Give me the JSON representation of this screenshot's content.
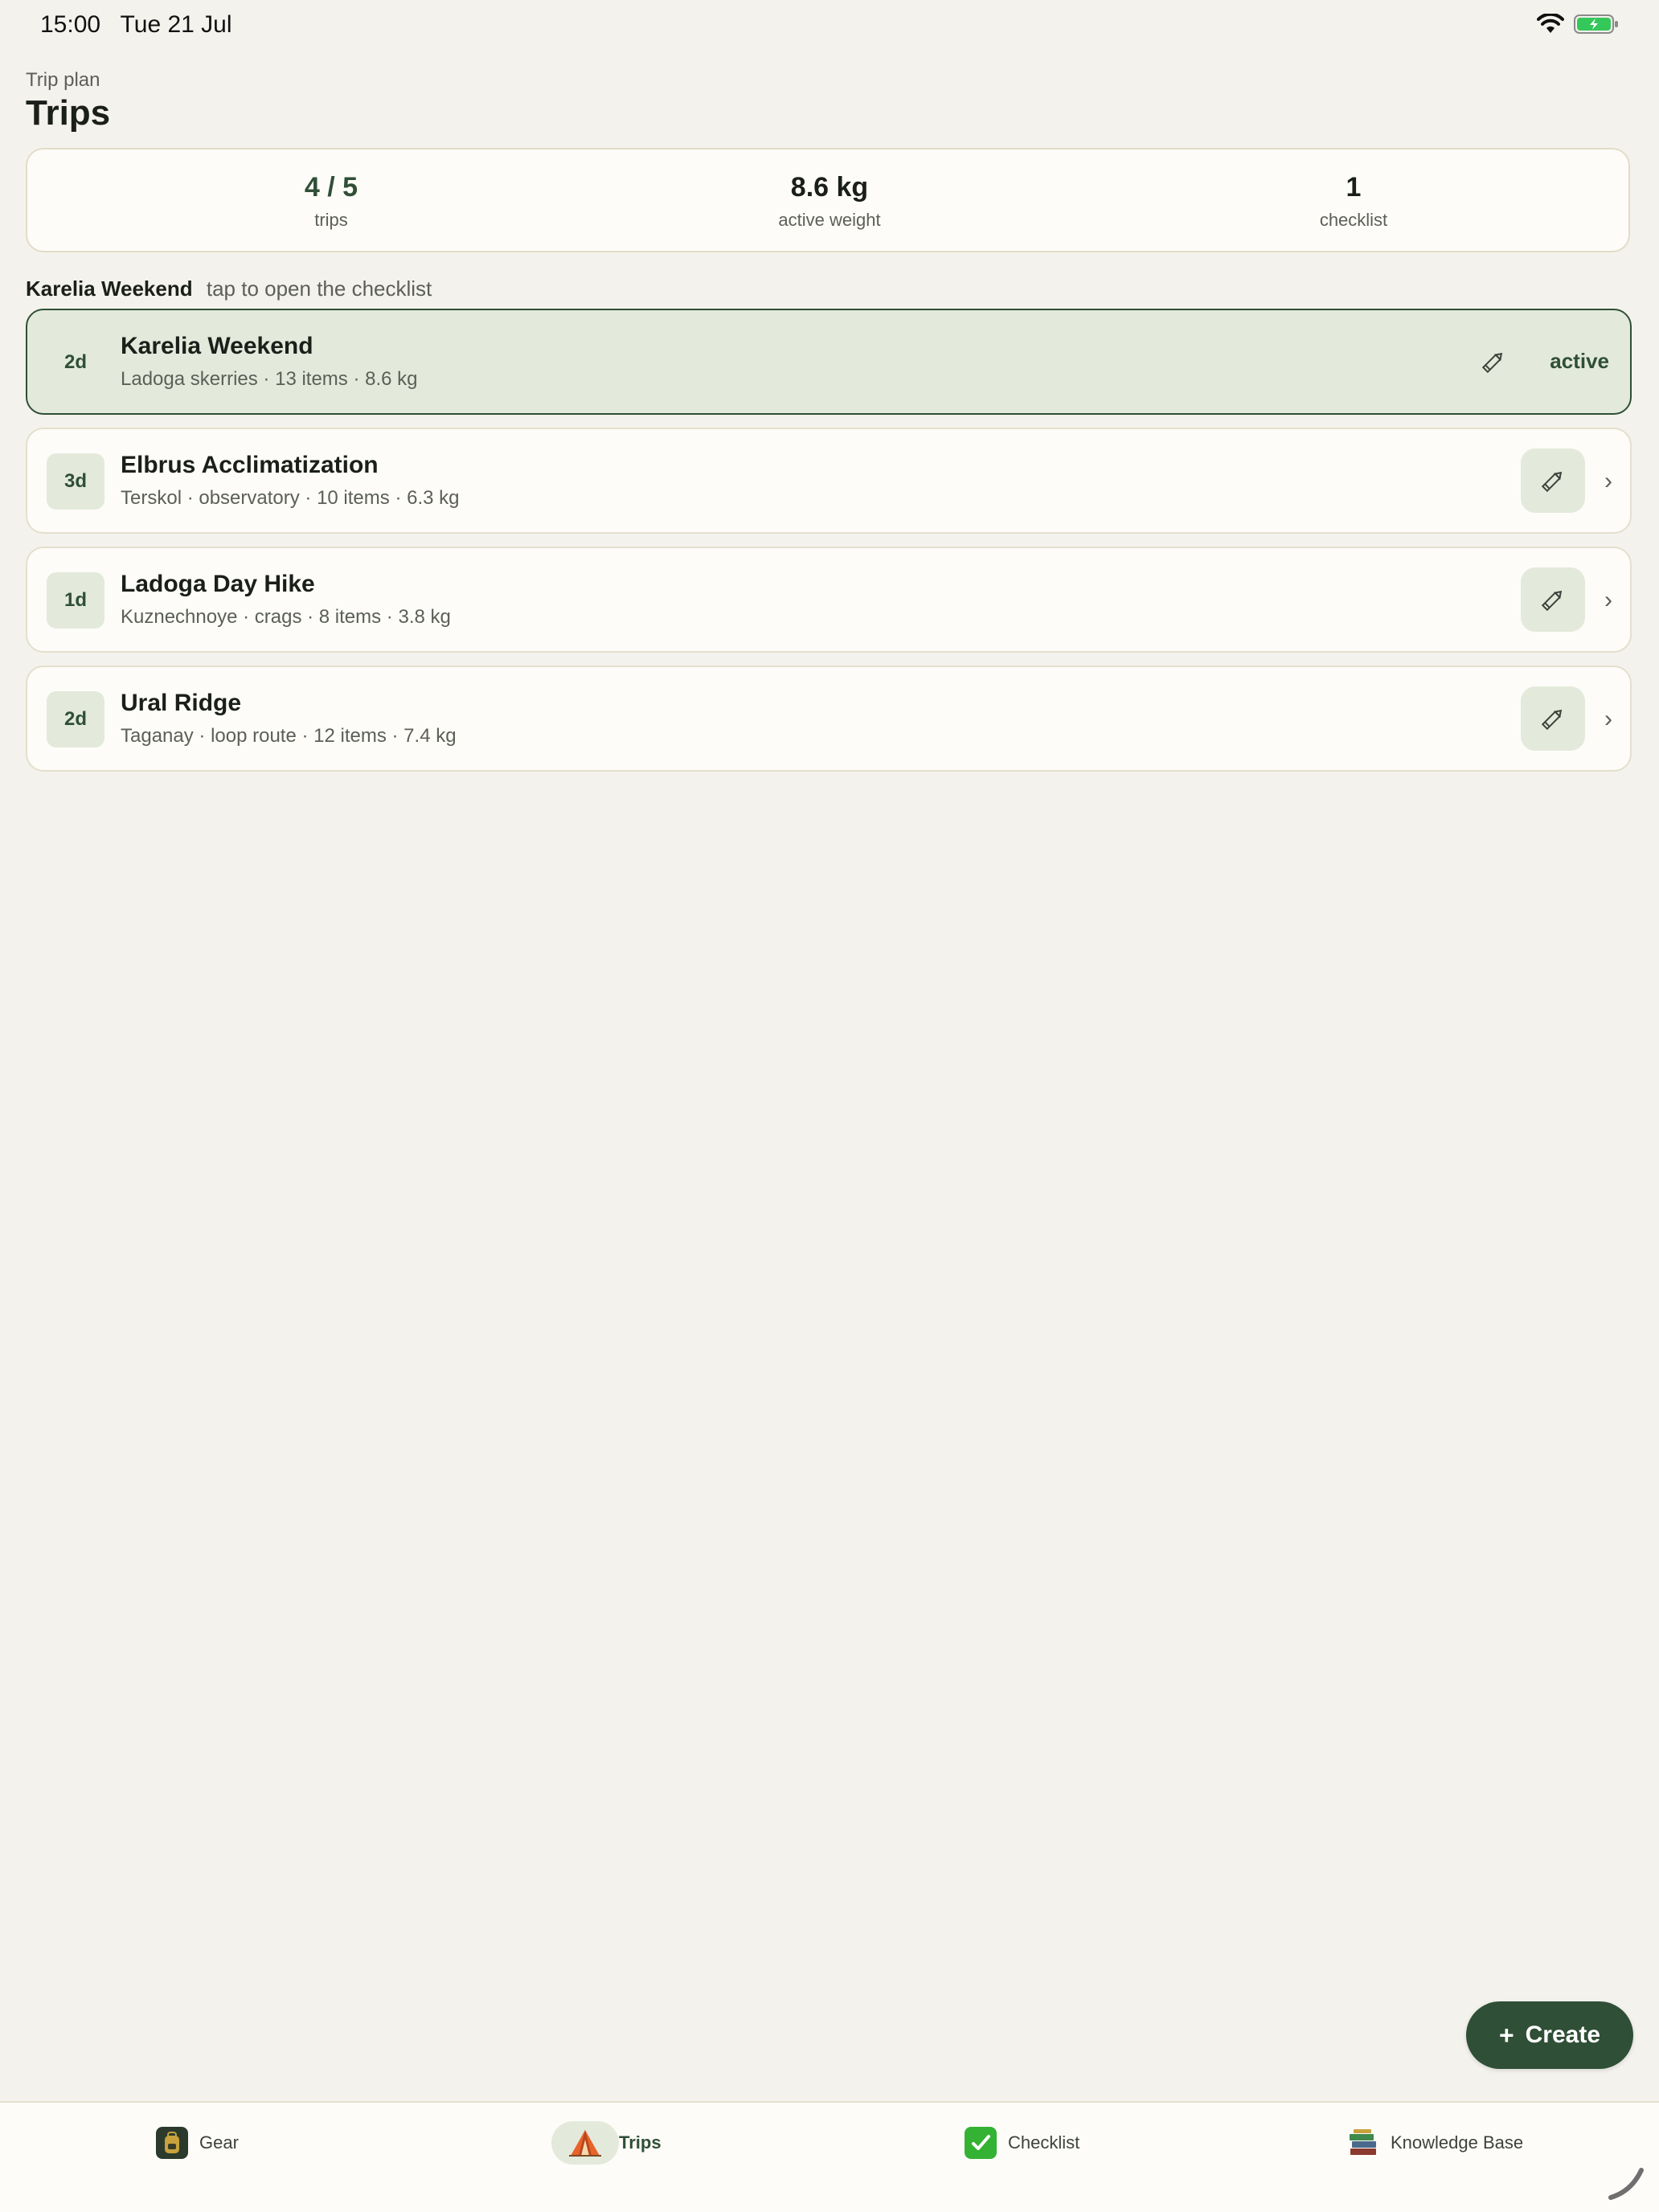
{
  "status": {
    "time": "15:00",
    "date": "Tue 21 Jul",
    "wifi_icon": "wifi-icon",
    "battery_icon": "battery-charging-icon"
  },
  "header": {
    "subtitle": "Trip plan",
    "title": "Trips"
  },
  "summary": {
    "trips_value": "4 / 5",
    "trips_label": "trips",
    "weight_value": "8.6 kg",
    "weight_label": "active weight",
    "checklist_value": "1",
    "checklist_label": "checklist"
  },
  "section": {
    "title": "Karelia Weekend",
    "hint": "tap to open the checklist"
  },
  "trips": [
    {
      "days": "2d",
      "name": "Karelia Weekend",
      "details": "Ladoga skerries · 13 items · 8.6 kg",
      "status": "active"
    },
    {
      "days": "3d",
      "name": "Elbrus Acclimatization",
      "details": "Terskol · observatory · 10 items · 6.3 kg"
    },
    {
      "days": "1d",
      "name": "Ladoga Day Hike",
      "details": "Kuznechnoye · crags · 8 items · 3.8 kg"
    },
    {
      "days": "2d",
      "name": "Ural Ridge",
      "details": "Taganay · loop route · 12 items · 7.4 kg"
    }
  ],
  "fab": {
    "label": "Create",
    "plus": "+"
  },
  "tabs": [
    {
      "label": "Gear",
      "icon": "backpack-icon"
    },
    {
      "label": "Trips",
      "icon": "tent-icon"
    },
    {
      "label": "Checklist",
      "icon": "checkmark-icon"
    },
    {
      "label": "Knowledge Base",
      "icon": "books-icon"
    }
  ],
  "colors": {
    "accent": "#2f4f36",
    "accent_light": "#e3eadb",
    "background": "#f4f2ed",
    "card": "#fdfcf8"
  }
}
